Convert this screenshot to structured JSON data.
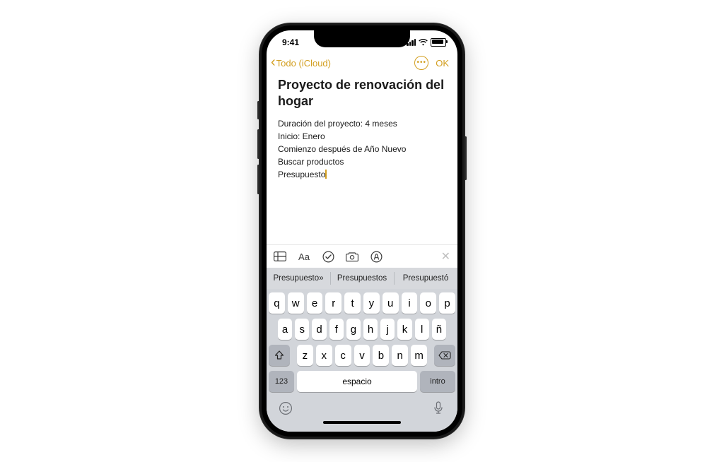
{
  "status": {
    "time": "9:41"
  },
  "nav": {
    "back_label": "Todo (iCloud)",
    "done_label": "OK"
  },
  "note": {
    "title": "Proyecto de renovación del hogar",
    "lines": [
      "Duración del proyecto: 4 meses",
      "Inicio: Enero",
      "Comienzo después de Año Nuevo",
      "Buscar productos",
      "Presupuesto"
    ]
  },
  "suggestions": [
    "Presupuesto»",
    "Presupuestos",
    "Presupuestó"
  ],
  "keyboard": {
    "row1": [
      "q",
      "w",
      "e",
      "r",
      "t",
      "y",
      "u",
      "i",
      "o",
      "p"
    ],
    "row2": [
      "a",
      "s",
      "d",
      "f",
      "g",
      "h",
      "j",
      "k",
      "l",
      "ñ"
    ],
    "row3": [
      "z",
      "x",
      "c",
      "v",
      "b",
      "n",
      "m"
    ],
    "num_label": "123",
    "space_label": "espacio",
    "return_label": "intro"
  }
}
